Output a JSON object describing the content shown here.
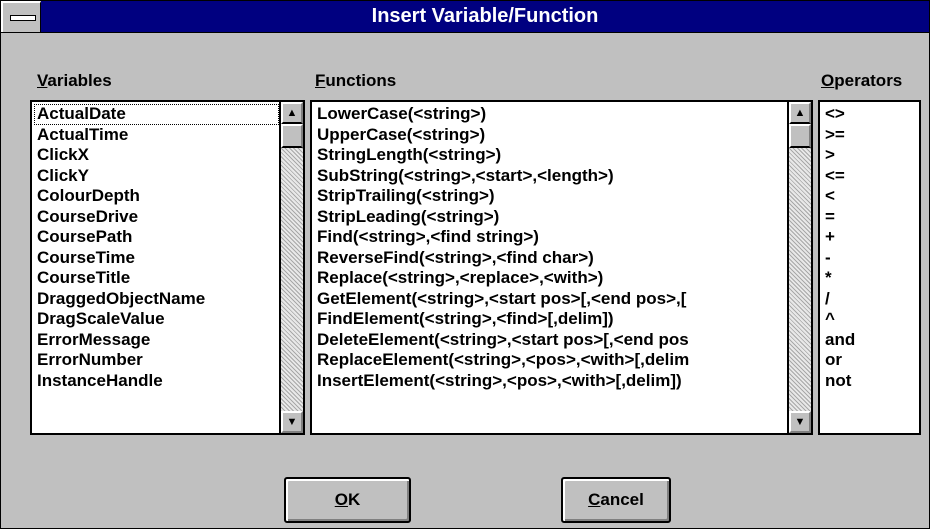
{
  "window": {
    "title": "Insert Variable/Function"
  },
  "variables": {
    "mnemonic": "V",
    "label_rest": "ariables",
    "selected_index": 0,
    "items": [
      "ActualDate",
      "ActualTime",
      "ClickX",
      "ClickY",
      "ColourDepth",
      "CourseDrive",
      "CoursePath",
      "CourseTime",
      "CourseTitle",
      "DraggedObjectName",
      "DragScaleValue",
      "ErrorMessage",
      "ErrorNumber",
      "InstanceHandle"
    ],
    "scroll_up_icon": "arrow-up-icon",
    "scroll_down_icon": "arrow-down-icon"
  },
  "functions": {
    "mnemonic": "F",
    "label_rest": "unctions",
    "items": [
      "LowerCase(<string>)",
      "UpperCase(<string>)",
      "StringLength(<string>)",
      "SubString(<string>,<start>,<length>)",
      "StripTrailing(<string>)",
      "StripLeading(<string>)",
      "Find(<string>,<find string>)",
      "ReverseFind(<string>,<find char>)",
      "Replace(<string>,<replace>,<with>)",
      "GetElement(<string>,<start pos>[,<end pos>,[",
      "FindElement(<string>,<find>[,delim])",
      "DeleteElement(<string>,<start pos>[,<end pos",
      "ReplaceElement(<string>,<pos>,<with>[,delim",
      "InsertElement(<string>,<pos>,<with>[,delim])"
    ]
  },
  "operators": {
    "mnemonic": "O",
    "label_rest": "perators",
    "items": [
      "<>",
      ">=",
      ">",
      "<=",
      "<",
      "=",
      "+",
      "-",
      "*",
      "/",
      "^",
      "and",
      "or",
      "not"
    ]
  },
  "buttons": {
    "ok": {
      "mnemonic": "O",
      "rest": "K"
    },
    "cancel": {
      "mnemonic": "C",
      "rest": "ancel"
    }
  },
  "colors": {
    "titlebar": "#000080",
    "face": "#c0c0c0"
  }
}
